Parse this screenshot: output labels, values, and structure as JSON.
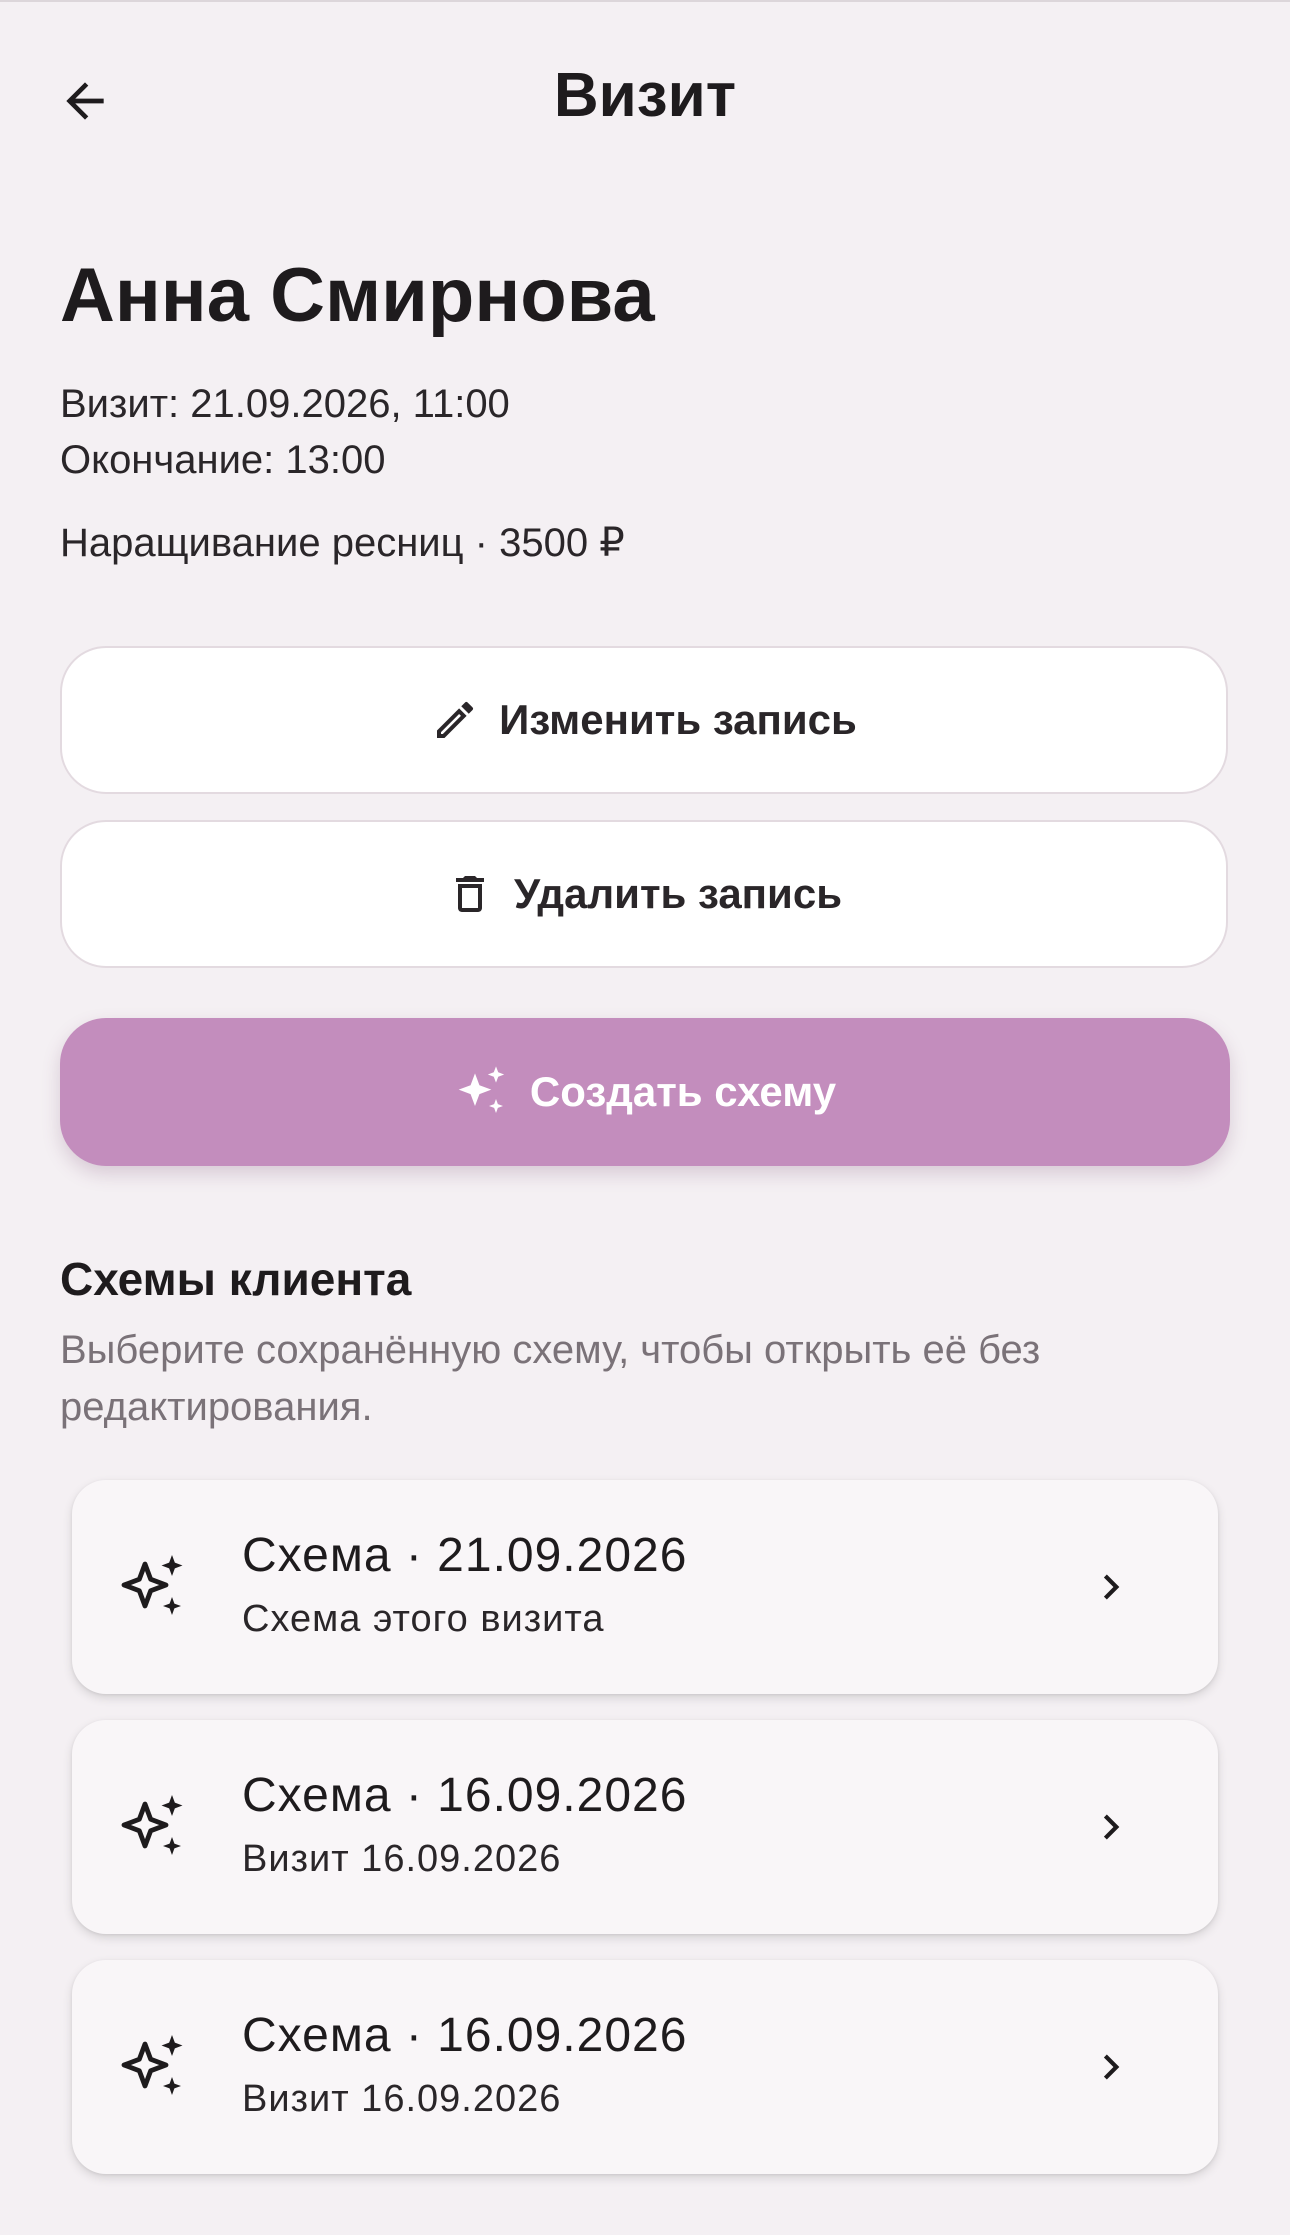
{
  "appbar": {
    "title": "Визит",
    "back_icon": "arrow-left-icon"
  },
  "visit": {
    "client_name": "Анна Смирнова",
    "visit_line": "Визит: 21.09.2026, 11:00",
    "end_line": "Окончание: 13:00",
    "service_line": "Наращивание ресниц · 3500 ₽"
  },
  "actions": {
    "edit_label": "Изменить запись",
    "edit_icon": "pencil-icon",
    "delete_label": "Удалить запись",
    "delete_icon": "trash-icon",
    "create_label": "Создать схему",
    "create_icon": "sparkles-icon"
  },
  "schemes": {
    "title": "Схемы клиента",
    "description": "Выберите сохранённую схему, чтобы открыть её без редактирования.",
    "items": [
      {
        "title": "Схема · 21.09.2026",
        "subtitle": "Схема этого визита",
        "icon": "sparkles-icon"
      },
      {
        "title": "Схема · 16.09.2026",
        "subtitle": "Визит 16.09.2026",
        "icon": "sparkles-icon"
      },
      {
        "title": "Схема · 16.09.2026",
        "subtitle": "Визит 16.09.2026",
        "icon": "sparkles-icon"
      }
    ]
  },
  "colors": {
    "background": "#F4F0F3",
    "accent": "#C38DBD",
    "text": "#1E1B1D",
    "muted": "#7A7278"
  }
}
